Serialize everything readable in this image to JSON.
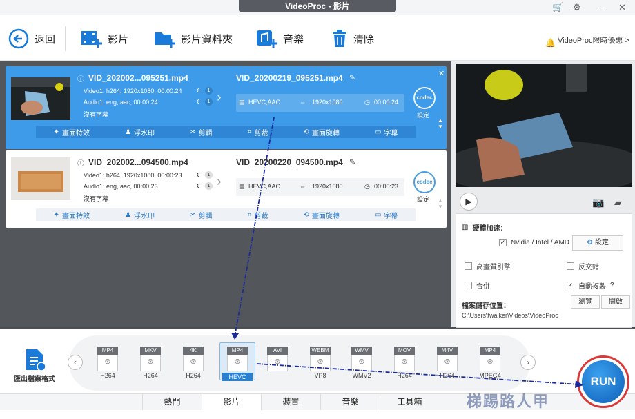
{
  "window": {
    "title": "VideoProc - 影片"
  },
  "toolbar": {
    "back": "返回",
    "video": "影片",
    "folder": "影片資料夾",
    "music": "音樂",
    "clear": "清除",
    "promo": "VideoProc限時優惠 >"
  },
  "items": [
    {
      "src_name": "VID_202002...095251.mp4",
      "video_meta": "Video1: h264, 1920x1080, 00:00:24",
      "audio_meta": "Audio1: eng, aac, 00:00:24",
      "subtitle": "沒有字幕",
      "video_count": "1",
      "audio_count": "1",
      "out_name": "VID_20200219_095251.mp4",
      "codec": "HEVC,AAC",
      "resolution": "1920x1080",
      "duration": "00:00:24"
    },
    {
      "src_name": "VID_202002...094500.mp4",
      "video_meta": "Video1: h264, 1920x1080, 00:00:23",
      "audio_meta": "Audio1: eng, aac, 00:00:23",
      "subtitle": "沒有字幕",
      "video_count": "1",
      "audio_count": "1",
      "out_name": "VID_20200220_094500.mp4",
      "codec": "HEVC,AAC",
      "resolution": "1920x1080",
      "duration": "00:00:23"
    }
  ],
  "strip": {
    "effects": "畫面特效",
    "watermark": "浮水印",
    "cut": "剪輯",
    "crop": "剪裁",
    "rotate": "畫面旋轉",
    "subs": "字幕"
  },
  "codec_icon": "codec",
  "settings_label": "設定",
  "settings": {
    "hw_title": "硬體加速：",
    "gpu": "Nvidia / Intel / AMD",
    "gpu_btn": "設定",
    "hq": "高畫質引擎",
    "deinterlace": "反交錯",
    "merge": "合併",
    "autocopy": "自動複製",
    "autocopy_q": "?",
    "save_title": "檔案儲存位置：",
    "browse": "瀏覽",
    "open": "開啟",
    "path": "C:\\Users\\twalker\\Videos\\VideoProc"
  },
  "export": {
    "label": "匯出檔案格式"
  },
  "formats": [
    {
      "head": "MP4",
      "sub": "H264"
    },
    {
      "head": "MKV",
      "sub": "H264"
    },
    {
      "head": "4K",
      "sub": "H264"
    },
    {
      "head": "MP4",
      "sub": "HEVC"
    },
    {
      "head": "AVI",
      "sub": ""
    },
    {
      "head": "WEBM",
      "sub": "VP8"
    },
    {
      "head": "WMV",
      "sub": "WMV2"
    },
    {
      "head": "MOV",
      "sub": "H264"
    },
    {
      "head": "M4V",
      "sub": "H264"
    },
    {
      "head": "MP4",
      "sub": "MPEG4"
    }
  ],
  "tabs": [
    "熱門",
    "影片",
    "裝置",
    "音樂",
    "工具箱"
  ],
  "run": "RUN",
  "watermark_text": "梯踢路人甲"
}
